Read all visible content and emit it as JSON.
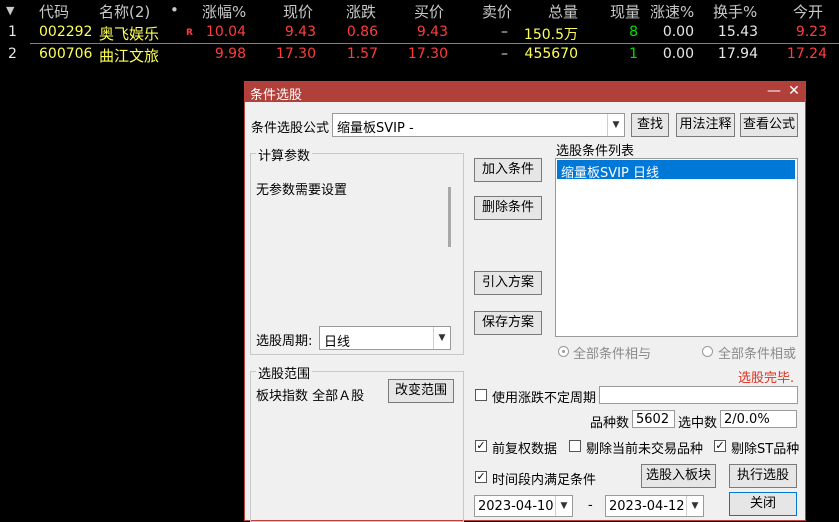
{
  "table": {
    "sort_glyph": "▼",
    "headers": [
      "代码",
      "名称(2)",
      "•",
      "涨幅%",
      "现价",
      "涨跌",
      "买价",
      "卖价",
      "总量",
      "现量",
      "涨速%",
      "换手%",
      "今开"
    ],
    "rows": [
      {
        "idx": "1",
        "code": "002292",
        "name": "奥飞娱乐",
        "flag": "R",
        "change_pct": "10.04",
        "price": "9.43",
        "change": "0.86",
        "bid": "9.43",
        "ask": "–",
        "volume": "150.5万",
        "cur_vol": "8",
        "speed": "0.00",
        "turnover": "15.43",
        "open": "9.23"
      },
      {
        "idx": "2",
        "code": "600706",
        "name": "曲江文旅",
        "flag": "",
        "change_pct": "9.98",
        "price": "17.30",
        "change": "1.57",
        "bid": "17.30",
        "ask": "–",
        "volume": "455670",
        "cur_vol": "1",
        "speed": "0.00",
        "turnover": "17.94",
        "open": "17.24"
      }
    ],
    "colors": {
      "up": "#ff3c3c",
      "cur_vol": "#00e000",
      "code": "#ffff54"
    }
  },
  "dialog": {
    "title": "条件选股",
    "min_glyph": "—",
    "close_glyph": "✕",
    "formula_label": "条件选股公式",
    "formula_value": "缩量板SVIP  -",
    "find_btn": "查找",
    "usage_btn": "用法注释",
    "view_btn": "查看公式",
    "params_group": "计算参数",
    "params_text": "无参数需要设置",
    "add_btn": "加入条件",
    "del_btn": "删除条件",
    "import_btn": "引入方案",
    "save_btn": "保存方案",
    "cond_list_label": "选股条件列表",
    "cond_items": [
      "缩量板SVIP  日线"
    ],
    "period_label": "选股周期:",
    "period_value": "日线",
    "radio_and": "全部条件相与",
    "radio_or": "全部条件相或",
    "status": "选股完毕.",
    "range_group": "选股范围",
    "range_text": "板块指数 全部Ａ股",
    "change_range_btn": "改变范围",
    "use_period_label": "使用涨跌不定周期",
    "count_label": "品种数",
    "count_value": "5602",
    "selected_label": "选中数",
    "selected_value": "2/0.0%",
    "pre_adj_label": "前复权数据",
    "exclude_untraded_label": "剔除当前未交易品种",
    "exclude_st_label": "剔除ST品种",
    "time_range_label": "时间段内满足条件",
    "to_block_btn": "选股入板块",
    "run_btn": "执行选股",
    "date_from": "2023-04-10",
    "date_sep": "-",
    "date_to": "2023-04-12",
    "close_btn": "关闭",
    "check_glyph": "✓",
    "accent": "#b2403a",
    "selection_bg": "#0078d7"
  }
}
